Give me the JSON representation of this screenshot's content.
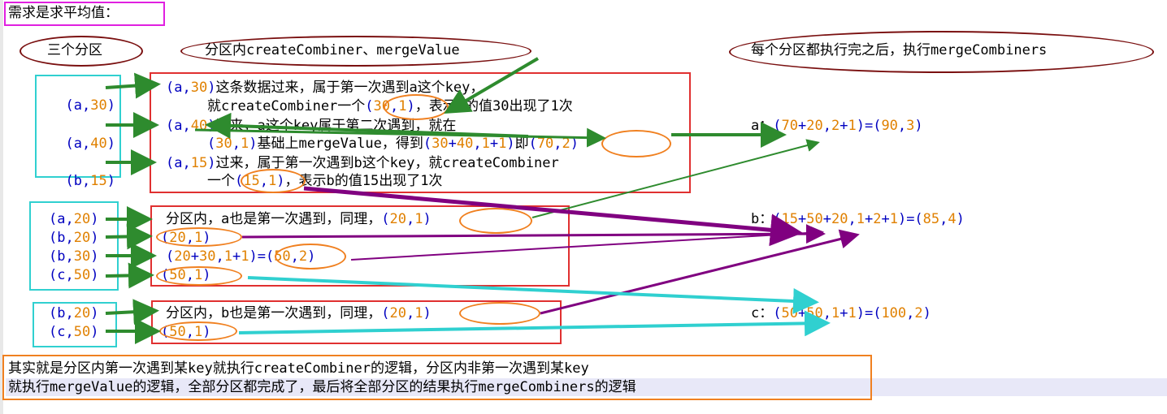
{
  "title": "需求是求平均值：",
  "headers": {
    "partitions": "三个分区",
    "in_partition": "分区内createCombiner、mergeValue",
    "after": "每个分区都执行完之后，执行mergeCombiners"
  },
  "partition1": {
    "items": [
      "(a,30)",
      "(a,40)",
      "(b,15)"
    ],
    "lines": [
      "(a,30)这条数据过来，属于第一次遇到a这个key，",
      "就createCombiner一个(30,1)，表示a的值30出现了1次",
      "(a,40)过来，a这个key属于第二次遇到，就在",
      "(30,1)基础上mergeValue，得到(30+40,1+1)即(70,2)",
      "(a,15)过来，属于第一次遇到b这个key，就createCombiner",
      "一个(15,1)，表示b的值15出现了1次"
    ]
  },
  "partition2": {
    "items": [
      "(a,20)",
      "(b,20)",
      "(b,30)",
      "(c,50)"
    ],
    "lines": [
      "分区内，a也是第一次遇到，同理，(20,1)",
      "(20,1)",
      "(20+30,1+1)=(50,2)",
      "(50,1)"
    ]
  },
  "partition3": {
    "items": [
      "(b,20)",
      "(c,50)"
    ],
    "lines": [
      "分区内，b也是第一次遇到，同理，(20,1)",
      "(50,1)"
    ]
  },
  "results": [
    "a：(70+20,2+1)=(90,3)",
    "b：(15+50+20,1+2+1)=(85,4)",
    "c：(50+50,1+1)=(100,2)"
  ],
  "summary": [
    "其实就是分区内第一次遇到某key就执行createCombiner的逻辑，分区内非第一次遇到某key",
    "就执行mergeValue的逻辑，全部分区都完成了，最后将全部分区的结果执行mergeCombiners的逻辑"
  ],
  "colors": {
    "keyword": "#0000c0",
    "number": "#e08000",
    "green_arrow": "#2e8b2e",
    "purple_arrow": "#800080",
    "cyan_arrow": "#30d0d0",
    "red_box": "#e03030",
    "cyan_box": "#30d0d0",
    "orange": "#f08020",
    "dark_red_ellipse": "#7a1010",
    "title_box": "#e020e0"
  }
}
